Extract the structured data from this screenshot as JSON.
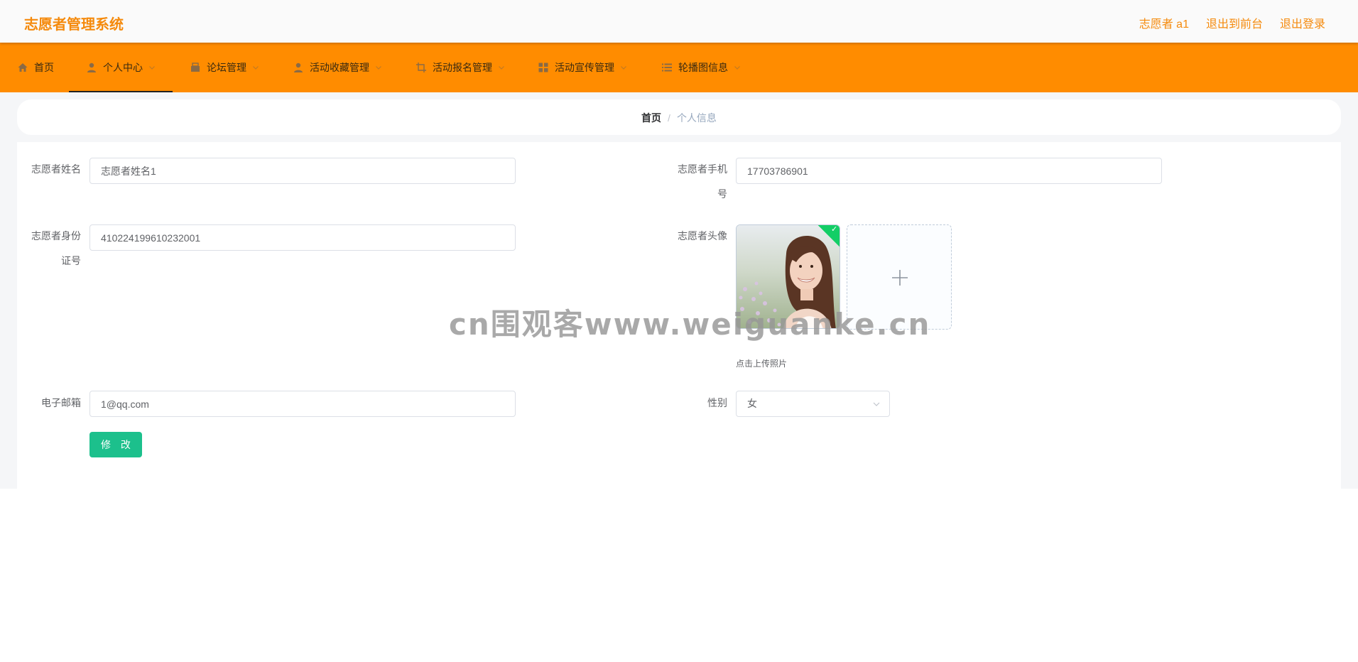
{
  "header": {
    "title": "志愿者管理系统",
    "user_label": "志愿者 a1",
    "back_front": "退出到前台",
    "logout": "退出登录"
  },
  "nav": {
    "items": [
      {
        "label": "首页",
        "icon": "home-icon"
      },
      {
        "label": "个人中心",
        "icon": "user-icon"
      },
      {
        "label": "论坛管理",
        "icon": "forum-icon"
      },
      {
        "label": "活动收藏管理",
        "icon": "user-icon"
      },
      {
        "label": "活动报名管理",
        "icon": "crop-icon"
      },
      {
        "label": "活动宣传管理",
        "icon": "grid-icon"
      },
      {
        "label": "轮播图信息",
        "icon": "list-icon"
      }
    ]
  },
  "breadcrumb": {
    "home": "首页",
    "separator": "/",
    "current": "个人信息"
  },
  "form": {
    "name_label": "志愿者姓名",
    "name_value": "志愿者姓名1",
    "phone_label": "志愿者手机号",
    "phone_value": "17703786901",
    "idcard_label": "志愿者身份证号",
    "idcard_value": "410224199610232001",
    "avatar_label": "志愿者头像",
    "upload_tip": "点击上传照片",
    "email_label": "电子邮箱",
    "email_value": "1@qq.com",
    "gender_label": "性别",
    "gender_value": "女",
    "submit_label": "修 改"
  },
  "watermark": "cn围观客www.weiguanke.cn",
  "colors": {
    "brand": "#f58a0c",
    "nav_bg": "#ff8c00",
    "submit_bg": "#1cc08c",
    "success": "#13ce66"
  }
}
